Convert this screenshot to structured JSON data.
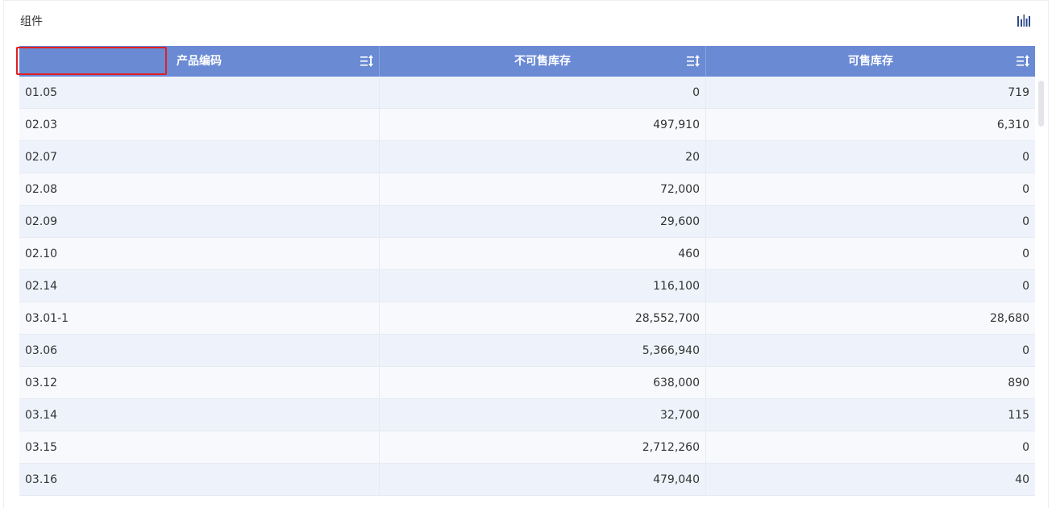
{
  "panel": {
    "title": "组件"
  },
  "table": {
    "columns": [
      {
        "label": "产品编码"
      },
      {
        "label": "不可售库存"
      },
      {
        "label": "可售库存"
      }
    ],
    "rows": [
      {
        "code": "01.05",
        "unsellable": "0",
        "sellable": "719"
      },
      {
        "code": "02.03",
        "unsellable": "497,910",
        "sellable": "6,310"
      },
      {
        "code": "02.07",
        "unsellable": "20",
        "sellable": "0"
      },
      {
        "code": "02.08",
        "unsellable": "72,000",
        "sellable": "0"
      },
      {
        "code": "02.09",
        "unsellable": "29,600",
        "sellable": "0"
      },
      {
        "code": "02.10",
        "unsellable": "460",
        "sellable": "0"
      },
      {
        "code": "02.14",
        "unsellable": "116,100",
        "sellable": "0"
      },
      {
        "code": "03.01-1",
        "unsellable": "28,552,700",
        "sellable": "28,680"
      },
      {
        "code": "03.06",
        "unsellable": "5,366,940",
        "sellable": "0"
      },
      {
        "code": "03.12",
        "unsellable": "638,000",
        "sellable": "890"
      },
      {
        "code": "03.14",
        "unsellable": "32,700",
        "sellable": "115"
      },
      {
        "code": "03.15",
        "unsellable": "2,712,260",
        "sellable": "0"
      },
      {
        "code": "03.16",
        "unsellable": "479,040",
        "sellable": "40"
      }
    ]
  },
  "icons": {
    "toolbar": "bar-chart-icon",
    "sort": "sort-icon"
  },
  "colors": {
    "header_bg": "#6a8ad4",
    "row_odd": "#eef3fb",
    "row_even": "#f7f9fd",
    "highlight": "#e02020",
    "tool_icon": "#2f4a8a"
  }
}
